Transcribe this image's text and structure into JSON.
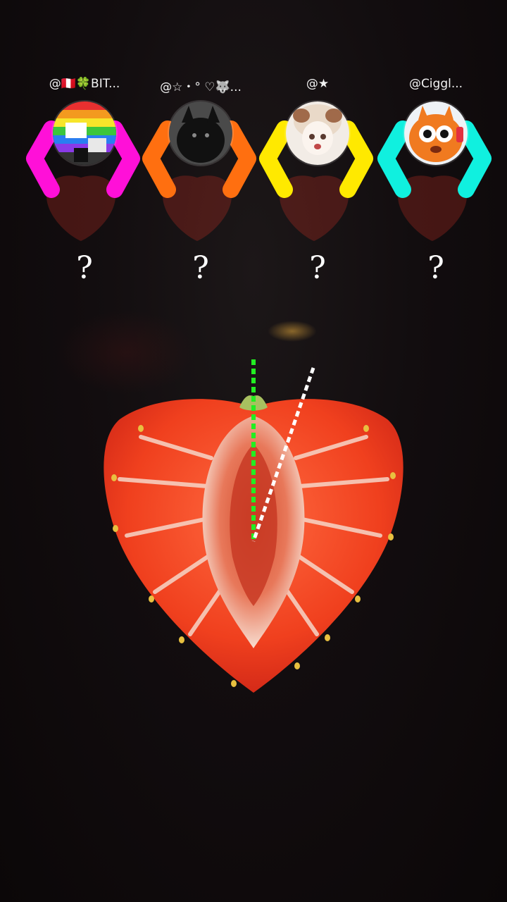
{
  "players": [
    {
      "handle": "@🇵🇪🍀BIT...",
      "guess": "?",
      "color": "#ff10d8",
      "avatar_icon": "rainbow-collage-avatar"
    },
    {
      "handle": "@☆・° ♡🐺...",
      "guess": "?",
      "color": "#ff6f10",
      "avatar_icon": "black-wolf-avatar"
    },
    {
      "handle": "@★",
      "guess": "?",
      "color": "#ffe900",
      "avatar_icon": "anime-girl-avatar"
    },
    {
      "handle": "@Ciggl...",
      "guess": "?",
      "color": "#10f0df",
      "avatar_icon": "orange-cartoon-avatar"
    }
  ],
  "target_line_color": "#22ee22",
  "pointer_line_color": "#ffffff"
}
